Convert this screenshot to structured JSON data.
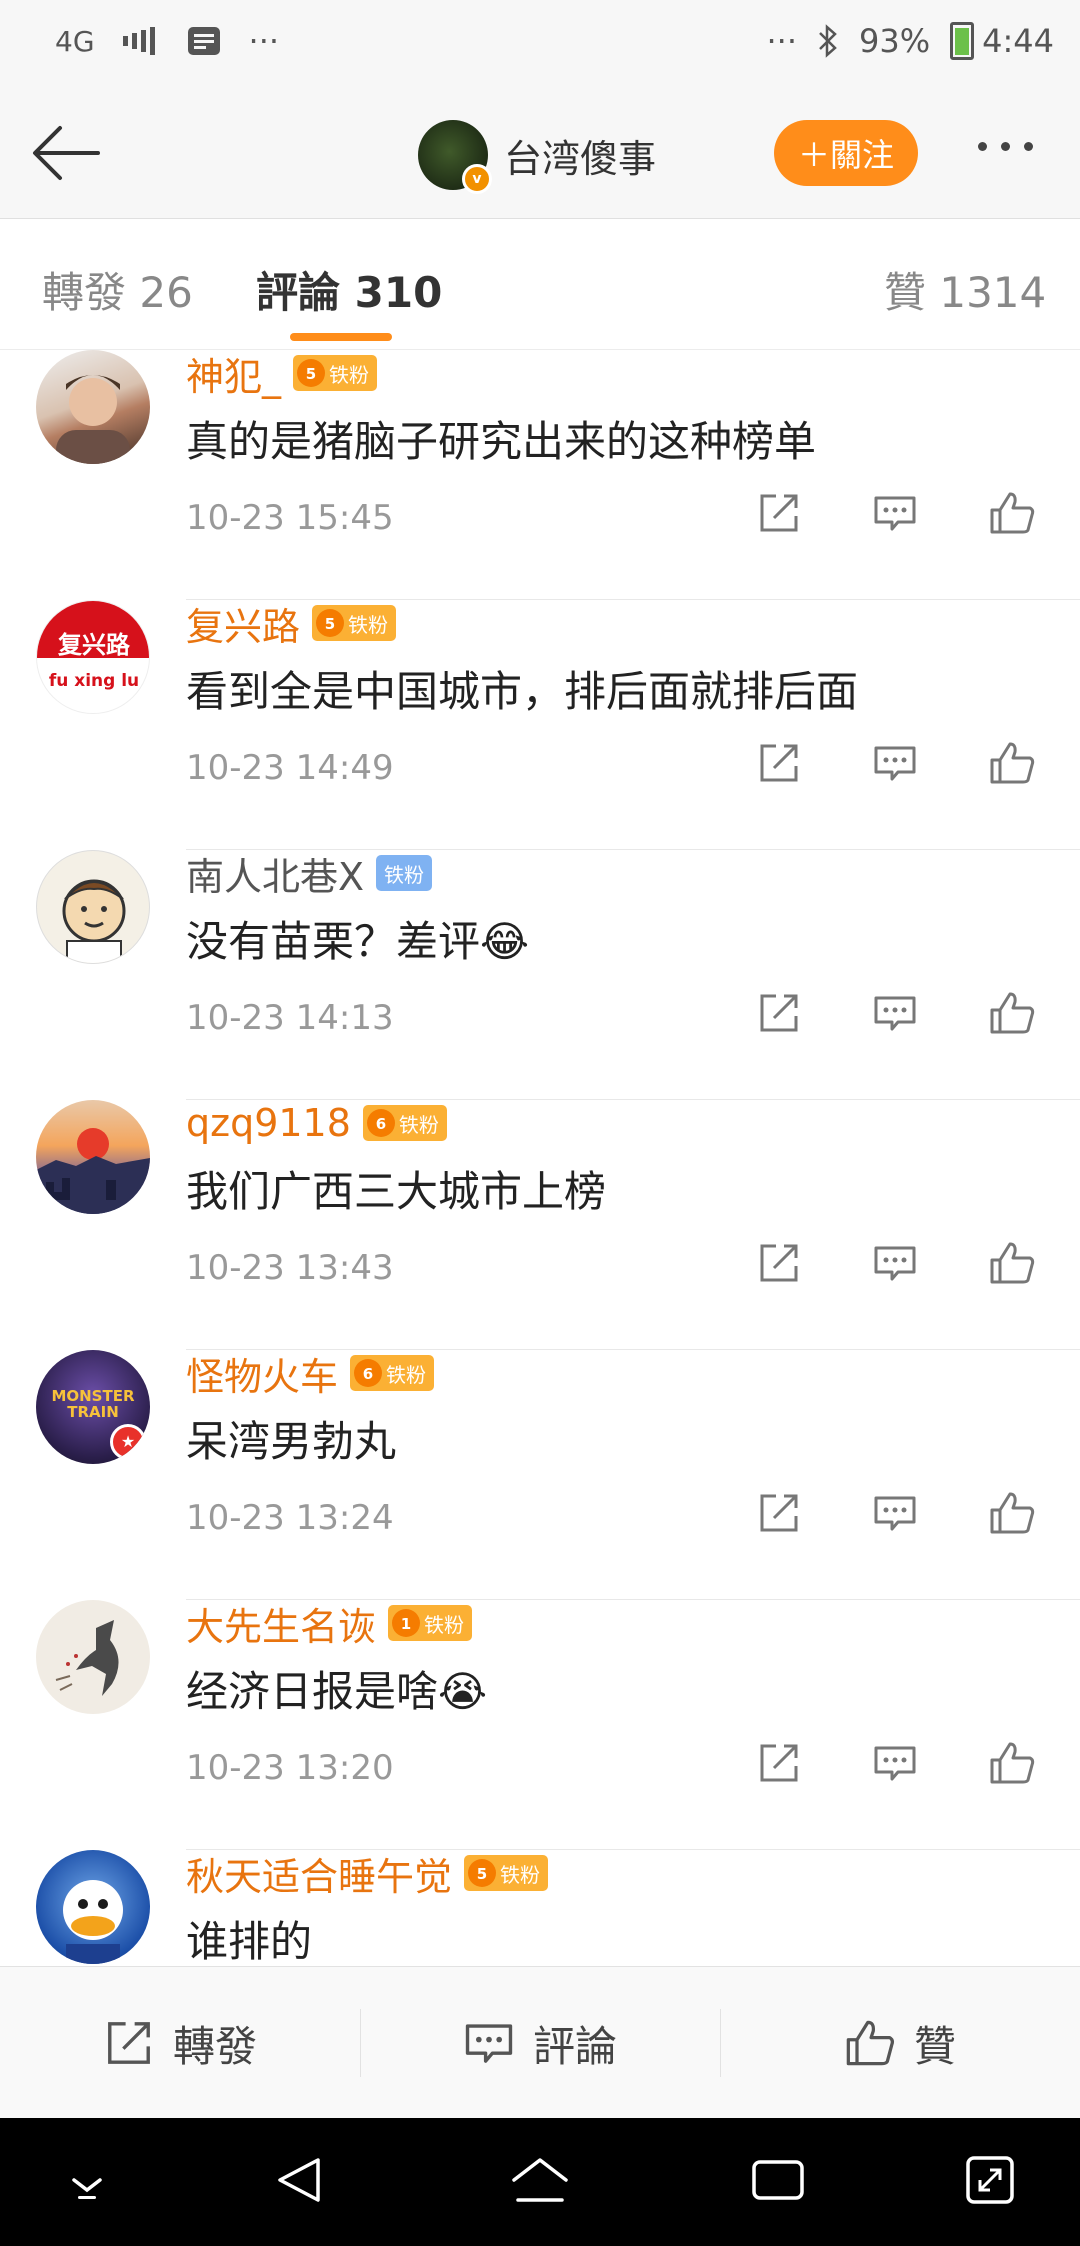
{
  "status": {
    "network": "4G",
    "dots_left": "···",
    "dots_right": "···",
    "battery": "93%",
    "time": "4:44"
  },
  "header": {
    "title": "台湾傻事",
    "follow_label": "＋關注"
  },
  "tabs": {
    "repost": "轉發 26",
    "comments": "評論 310",
    "likes": "贊 1314"
  },
  "comments": [
    {
      "name": "神犯_",
      "badge": "铁粉",
      "level": "5",
      "text": "真的是猪脑子研究出来的这种榜单",
      "time": "10-23 15:45",
      "name_color": "orange"
    },
    {
      "name": "复兴路",
      "badge": "铁粉",
      "level": "5",
      "text": "看到全是中国城市，排后面就排后面",
      "time": "10-23 14:49",
      "name_color": "orange",
      "avatar_title": "复兴路",
      "avatar_sub": "fu xing lu"
    },
    {
      "name": "南人北巷X",
      "badge": "铁粉",
      "level": "",
      "text": "没有苗栗？差评😂",
      "time": "10-23 14:13",
      "name_color": "gray"
    },
    {
      "name": "qzq9118",
      "badge": "铁粉",
      "level": "6",
      "text": "我们广西三大城市上榜",
      "time": "10-23 13:43",
      "name_color": "orange"
    },
    {
      "name": "怪物火车",
      "badge": "铁粉",
      "level": "6",
      "text": "呆湾男勃丸",
      "time": "10-23 13:24",
      "name_color": "orange",
      "avatar_title": "MONSTER TRAIN"
    },
    {
      "name": "大先生名诙",
      "badge": "铁粉",
      "level": "1",
      "text": "经济日报是啥😭",
      "time": "10-23 13:20",
      "name_color": "orange"
    },
    {
      "name": "秋天适合睡午觉",
      "badge": "铁粉",
      "level": "5",
      "text": "谁排的",
      "time": "",
      "name_color": "orange"
    }
  ],
  "bottom": {
    "repost": "轉發",
    "comment": "評論",
    "like": "贊"
  },
  "colors": {
    "accent": "#ff8d1a",
    "name_orange": "#e8740f"
  }
}
